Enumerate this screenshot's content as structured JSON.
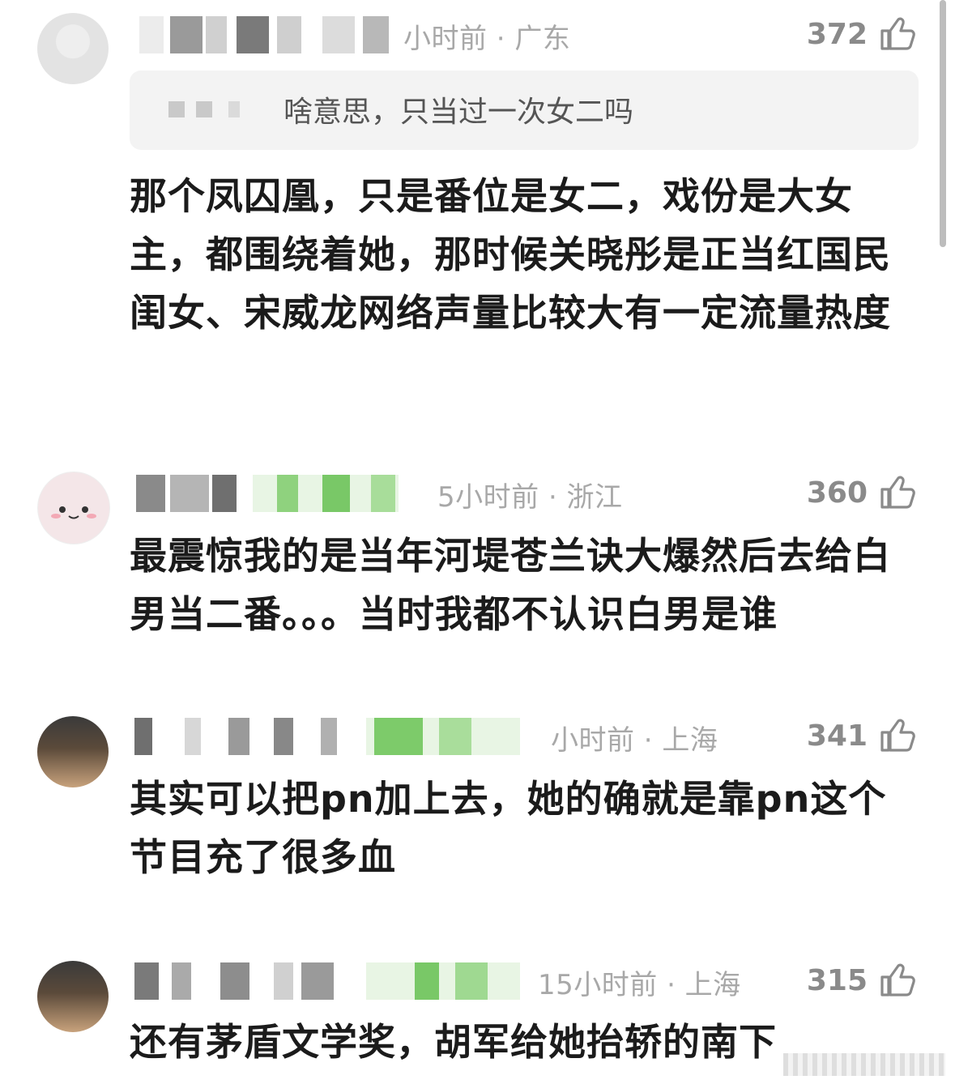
{
  "comments": [
    {
      "meta": "小时前 · 广东",
      "likes": "372",
      "quote": "啥意思，只当过一次女二吗",
      "text": "那个凤囚凰，只是番位是女二，戏份是大女主，都围绕着她，那时候关晓彤是正当红国民闺女、宋威龙网络声量比较大有一定流量热度"
    },
    {
      "meta": "5小时前 · 浙江",
      "likes": "360",
      "text": "最震惊我的是当年河堤苍兰诀大爆然后去给白男当二番。。。当时我都不认识白男是谁"
    },
    {
      "meta": "小时前 · 上海",
      "likes": "341",
      "text": "其实可以把pn加上去，她的确就是靠pn这个节目充了很多血"
    },
    {
      "meta": "15小时前 · 上海",
      "likes": "315",
      "text": "还有茅盾文学奖，胡军给她抬轿的南下"
    }
  ],
  "icons": {
    "like": "thumbs-up-icon",
    "avatar": "avatar"
  },
  "colors": {
    "meta": "#a8a8a8",
    "likes": "#8a8a8a",
    "text": "#1b1b1b",
    "quote_bg": "#f3f3f3"
  }
}
